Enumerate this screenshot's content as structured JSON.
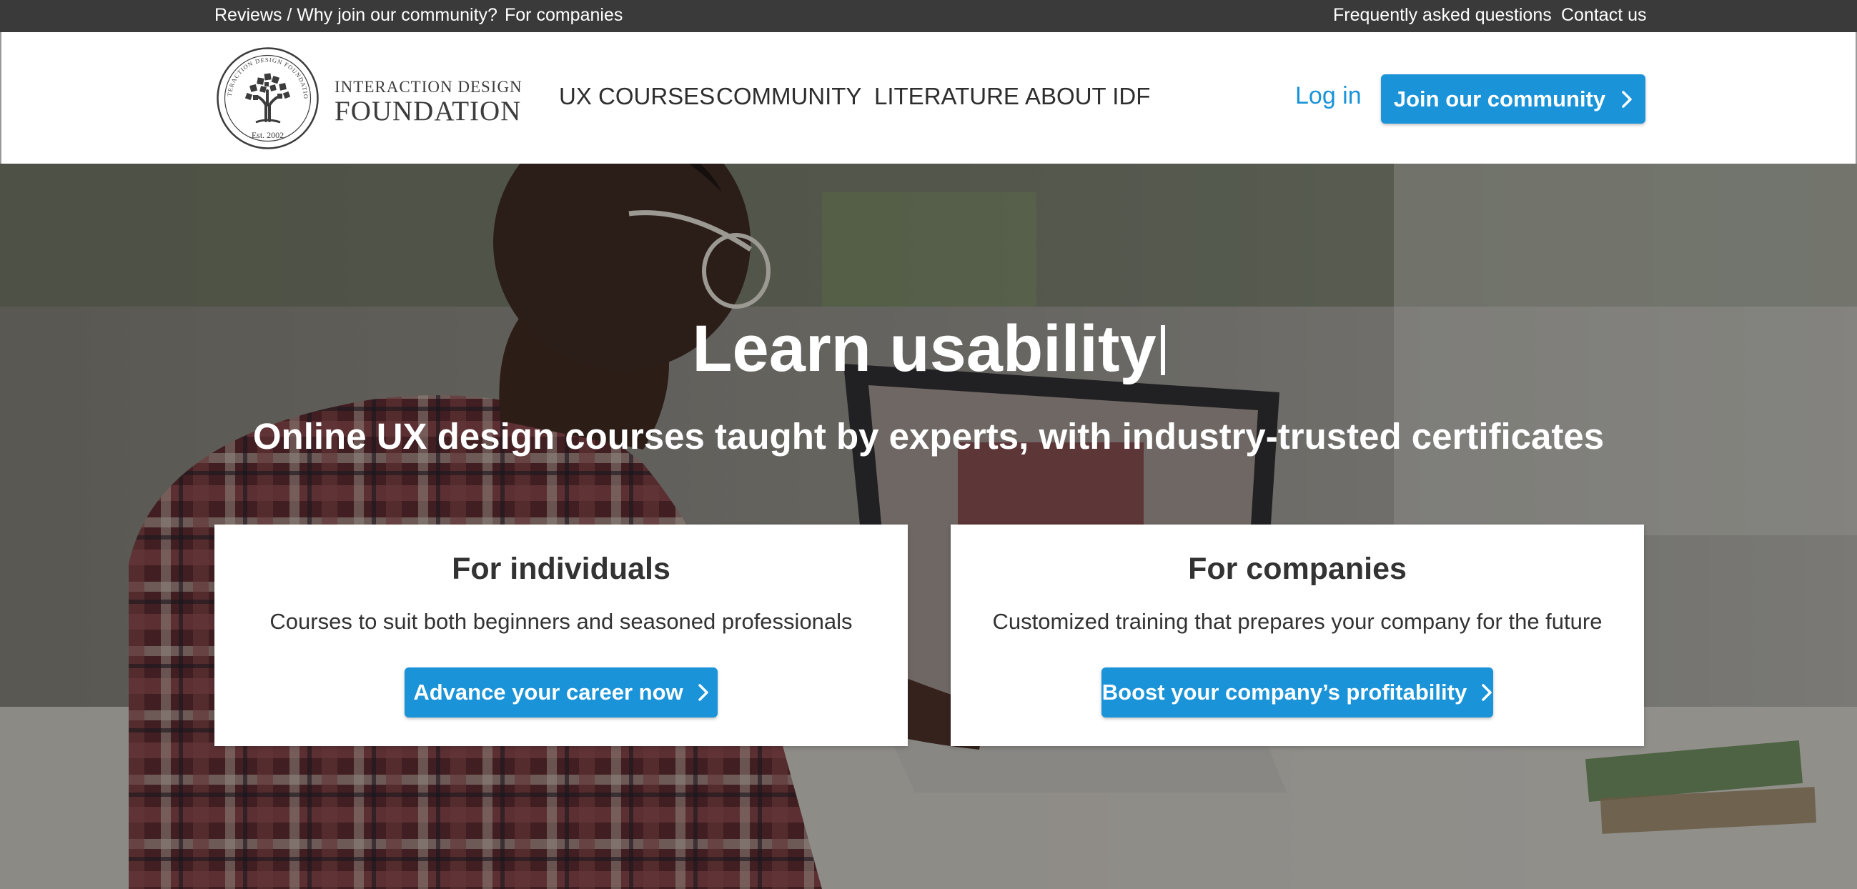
{
  "topbar": {
    "reviews": "Reviews / Why join our community?",
    "companies": "For companies",
    "faq": "Frequently asked questions",
    "contact": "Contact us"
  },
  "logo": {
    "line1": "INTERACTION DESIGN",
    "line2": "FOUNDATION"
  },
  "nav": {
    "items": [
      {
        "label": "UX COURSES"
      },
      {
        "label": "COMMUNITY"
      },
      {
        "label": "LITERATURE"
      },
      {
        "label": "ABOUT IDF"
      }
    ],
    "login": "Log in",
    "join": "Join our community"
  },
  "hero": {
    "title": "Learn usability",
    "subtitle": "Online UX design courses taught by experts, with industry-trusted certificates"
  },
  "cards": [
    {
      "title": "For individuals",
      "text": "Courses to suit both beginners and seasoned professionals",
      "button": "Advance your career now"
    },
    {
      "title": "For companies",
      "text": "Customized training that prepares your company for the future",
      "button": "Boost your company’s profitability"
    }
  ],
  "colors": {
    "accent": "#1a93d8",
    "topbar": "#3a3a3a",
    "text_dark": "#333333"
  },
  "icons": [
    "chevron-right-icon",
    "logo-tree-icon"
  ]
}
